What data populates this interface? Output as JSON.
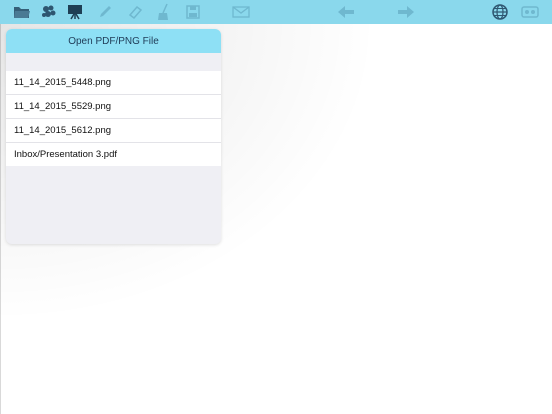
{
  "toolbar": {
    "icons": [
      "folder-icon",
      "palette-icon",
      "easel-icon",
      "pencil-icon",
      "eraser-icon",
      "broom-icon",
      "save-icon",
      "mail-icon",
      "undo-arrow-icon",
      "redo-arrow-icon",
      "globe-icon",
      "tape-icon"
    ],
    "color": "#8ad8ec"
  },
  "popover": {
    "title": "Open PDF/PNG File",
    "files": [
      "11_14_2015_5448.png",
      "11_14_2015_5529.png",
      "11_14_2015_5612.png",
      "Inbox/Presentation 3.pdf"
    ]
  }
}
